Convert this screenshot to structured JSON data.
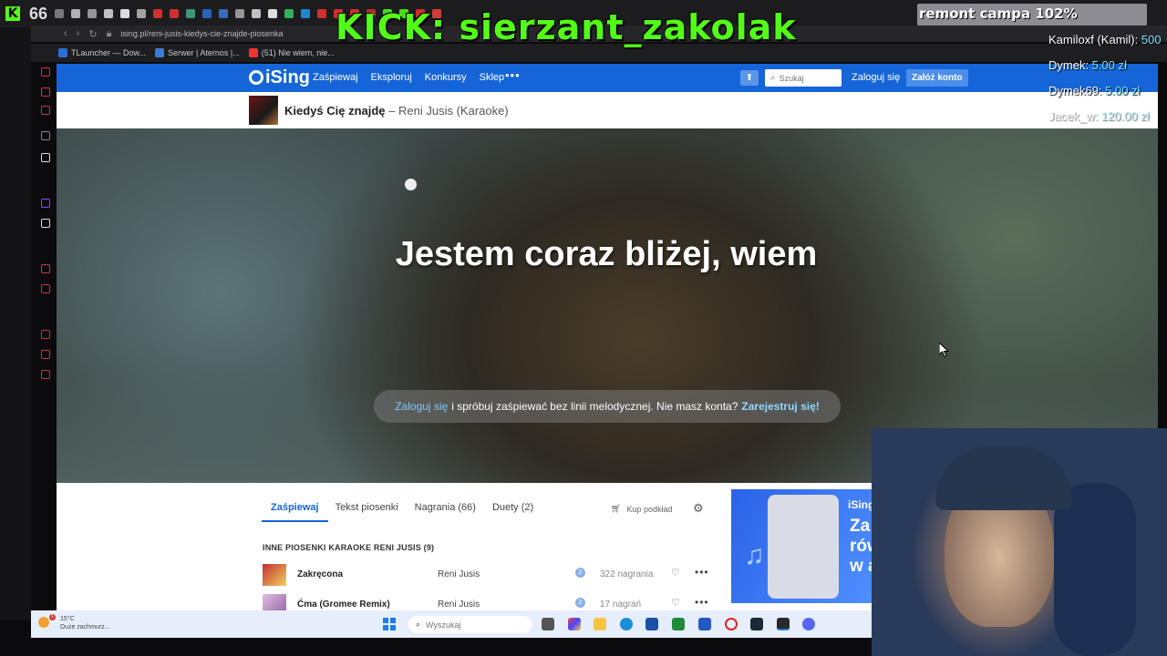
{
  "browser": {
    "tab_count": "66",
    "url": "ising.pl/reni-jusis-kiedys-cie-znajde-piosenka",
    "bookmarks": [
      {
        "label": "TLauncher — Dow...",
        "color": "#2b6fd6"
      },
      {
        "label": "Serwer | Aternos |...",
        "color": "#3a7bd5"
      },
      {
        "label": "(51) Nie wiem, nie...",
        "color": "#e33"
      }
    ]
  },
  "overlay": {
    "banner": "KICK: sierzant_zakolak",
    "goal_text": "remont campa 102%",
    "goal_progress": 1.0,
    "donations": [
      {
        "name": "Kamiloxf (Kamil): ",
        "amount": "500"
      },
      {
        "name": "Dymek: ",
        "amount": "5.00 zł"
      },
      {
        "name": "Dymek69: ",
        "amount": "5.00 zł"
      },
      {
        "name": "Jacek_w: ",
        "amount": "120.00 zł"
      }
    ],
    "accent": "#53fc18"
  },
  "ising": {
    "logo": "iSing",
    "nav": [
      "Zaśpiewaj",
      "Eksploruj",
      "Konkursy",
      "Sklep"
    ],
    "nav_more": "•••",
    "search_placeholder": "Szukaj",
    "login": "Zaloguj się",
    "register": "Załóż konto",
    "song": {
      "title": "Kiedyś Cię znajdę",
      "separator": " – ",
      "artist": "Reni Jusis (Karaoke)"
    },
    "lyric": "Jestem coraz bliżej, wiem",
    "prompt": {
      "login": "Zaloguj się",
      "text": "i spróbuj zaśpiewać bez linii melodycznej. Nie masz konta?",
      "register": "Zarejestruj się!"
    },
    "tabs": [
      "Zaśpiewaj",
      "Tekst piosenki",
      "Nagrania (66)",
      "Duety (2)"
    ],
    "buy": "Kup podkład",
    "section_title": "INNE PIOSENKI KARAOKE RENI JUSIS (9)",
    "songs": [
      {
        "name": "Zakręcona",
        "artist": "Reni Jusis",
        "badge": "2",
        "count": "322 nagrania"
      },
      {
        "name": "Ćma (Gromee Remix)",
        "artist": "Reni Jusis",
        "badge": "2",
        "count": "17 nagrań"
      }
    ],
    "promo_text": "Za\nrów\nw a",
    "promo_logo": "iSing",
    "brand_color": "#1565d8"
  },
  "taskbar": {
    "temperature": "15°C",
    "weather": "Duże zachmurz...",
    "weather_badge": "1",
    "search_placeholder": "Wyszukaj"
  }
}
